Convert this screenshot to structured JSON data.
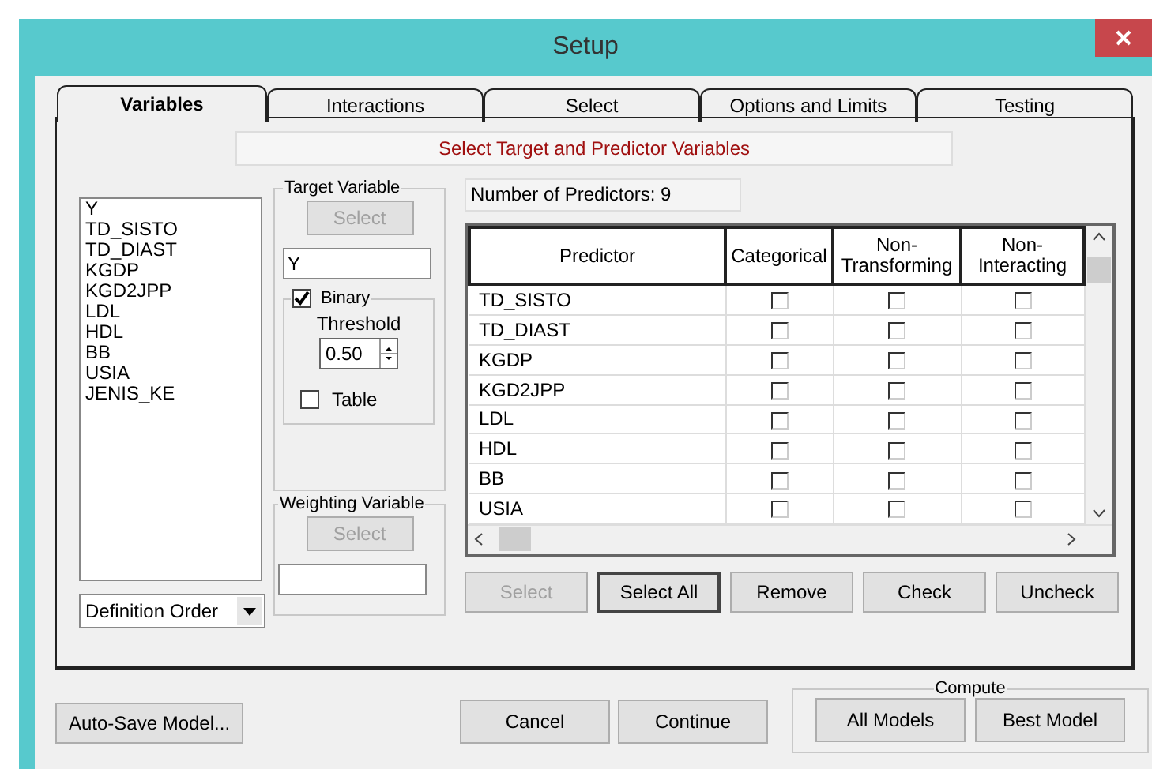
{
  "window": {
    "title": "Setup"
  },
  "tabs": [
    {
      "label": "Variables",
      "selected": true
    },
    {
      "label": "Interactions",
      "selected": false
    },
    {
      "label": "Select",
      "selected": false
    },
    {
      "label": "Options and Limits",
      "selected": false
    },
    {
      "label": "Testing",
      "selected": false
    }
  ],
  "banner": "Select Target and Predictor Variables",
  "variables": [
    "Y",
    "TD_SISTO",
    "TD_DIAST",
    "KGDP",
    "KGD2JPP",
    "LDL",
    "HDL",
    "BB",
    "USIA",
    "JENIS_KE"
  ],
  "order_dropdown": {
    "value": "Definition Order"
  },
  "target": {
    "title": "Target Variable",
    "select_button": {
      "label": "Select",
      "disabled": true
    },
    "value": "Y",
    "binary": {
      "label": "Binary",
      "checked": true
    },
    "threshold_label": "Threshold",
    "threshold": "0.50",
    "table": {
      "label": "Table",
      "checked": false
    }
  },
  "weighting": {
    "title": "Weighting Variable",
    "select_button": {
      "label": "Select",
      "disabled": true
    }
  },
  "predictor_count": "Number of Predictors: 9",
  "grid": {
    "columns": [
      "Predictor",
      "Categorical",
      "Non-\nTransforming",
      "Non-\nInteracting"
    ],
    "rows": [
      {
        "name": "TD_SISTO",
        "categorical": false,
        "non_transforming": false,
        "non_interacting": false
      },
      {
        "name": "TD_DIAST",
        "categorical": false,
        "non_transforming": false,
        "non_interacting": false
      },
      {
        "name": "KGDP",
        "categorical": false,
        "non_transforming": false,
        "non_interacting": false
      },
      {
        "name": "KGD2JPP",
        "categorical": false,
        "non_transforming": false,
        "non_interacting": false
      },
      {
        "name": "LDL",
        "categorical": false,
        "non_transforming": false,
        "non_interacting": false
      },
      {
        "name": "HDL",
        "categorical": false,
        "non_transforming": false,
        "non_interacting": false
      },
      {
        "name": "BB",
        "categorical": false,
        "non_transforming": false,
        "non_interacting": false
      },
      {
        "name": "USIA",
        "categorical": false,
        "non_transforming": false,
        "non_interacting": false
      }
    ]
  },
  "grid_buttons": [
    {
      "label": "Select",
      "disabled": true
    },
    {
      "label": "Select All",
      "disabled": false
    },
    {
      "label": "Remove",
      "disabled": false
    },
    {
      "label": "Check",
      "disabled": false
    },
    {
      "label": "Uncheck",
      "disabled": false
    }
  ],
  "autosave_button": "Auto-Save Model...",
  "dialog_buttons": [
    "Cancel",
    "Continue"
  ],
  "compute": {
    "title": "Compute",
    "buttons": [
      "All Models",
      "Best Model"
    ]
  }
}
